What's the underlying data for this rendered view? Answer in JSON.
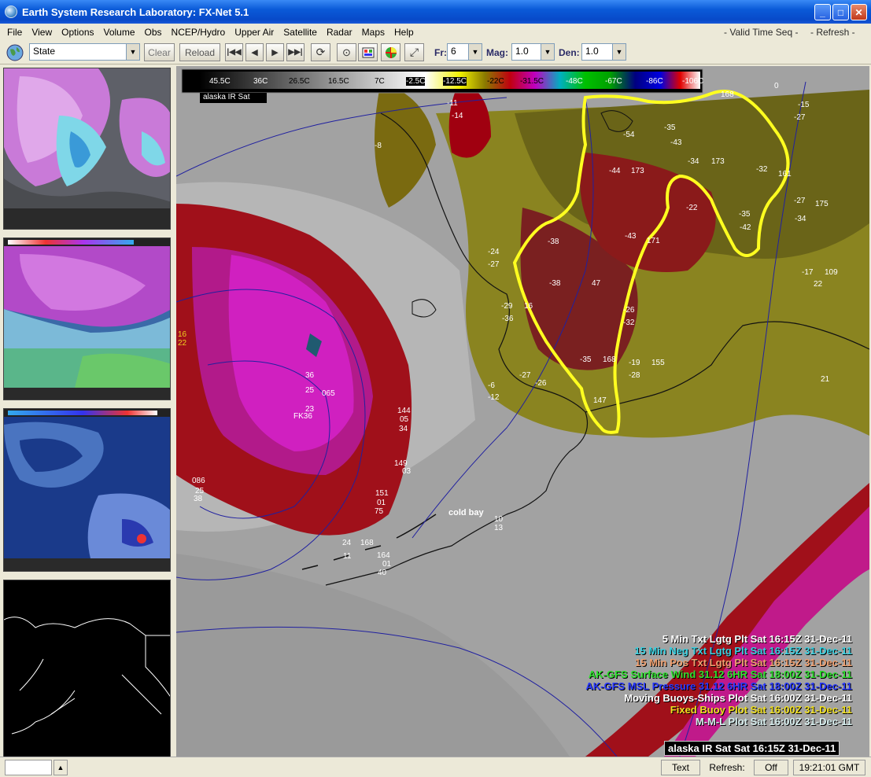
{
  "window": {
    "title": "Earth System Research Laboratory: FX-Net 5.1",
    "minimize": "_",
    "maximize": "□",
    "close": "✕"
  },
  "menu": {
    "items": [
      "File",
      "View",
      "Options",
      "Volume",
      "Obs",
      "NCEP/Hydro",
      "Upper Air",
      "Satellite",
      "Radar",
      "Maps",
      "Help"
    ],
    "valid_time_seq": "- Valid Time Seq -",
    "refresh": "- Refresh -"
  },
  "toolbar": {
    "scale_value": "State",
    "clear_label": "Clear",
    "reload_label": "Reload",
    "frames_label": "Fr:",
    "frames_value": "6",
    "mag_label": "Mag:",
    "mag_value": "1.0",
    "den_label": "Den:",
    "den_value": "1.0"
  },
  "colorbar": {
    "labels": [
      "45.5C",
      "36C",
      "26.5C",
      "16.5C",
      "7C",
      "-2.5C",
      "-12.5C",
      "-22C",
      "-31.5C",
      "-48C",
      "-67C",
      "-86C",
      "-106C"
    ],
    "product": "alaska IR Sat"
  },
  "map_labels": {
    "cold_bay": "cold bay",
    "station_numbers": [
      "-11",
      "-14",
      "-8",
      "-54",
      "-43",
      "-35",
      "-34",
      "173",
      "168",
      "-15",
      "-27",
      "-44",
      "173",
      "-32",
      "161",
      "-27",
      "175",
      "-34",
      "-22",
      "-35",
      "-42",
      "-38",
      "-43",
      "171",
      "-24",
      "-27",
      "-17",
      "109",
      "22",
      "-38",
      "47",
      "-29",
      "16",
      "-36",
      "-26",
      "-32",
      "-35",
      "168",
      "-19",
      "155",
      "-28",
      "-27",
      "-26",
      "147",
      "-6",
      "-12",
      "36",
      "25",
      "065",
      "23",
      "FK36",
      "144",
      "05",
      "34",
      "149",
      "03",
      "151",
      "01",
      "75",
      "24",
      "168",
      "11",
      "164",
      "01",
      "40",
      "086",
      "25",
      "38",
      "10",
      "13",
      "21",
      "0",
      "16",
      "22"
    ]
  },
  "legend": [
    {
      "text": "5 Min Txt Lgtg Plt Sat 16:15Z 31-Dec-11",
      "color": "#ffffff"
    },
    {
      "text": "15 Min Neg Txt Lgtg Plt Sat 16:15Z 31-Dec-11",
      "color": "#3ad0e0"
    },
    {
      "text": "15 Min Pos Txt Lgtg Plt Sat 16:15Z 31-Dec-11",
      "color": "#f0a070"
    },
    {
      "text": "AK-GFS Surface Wind  31.12   6HR Sat 18:00Z 31-Dec-11",
      "color": "#30e030"
    },
    {
      "text": "AK-GFS MSL Pressure  31.12   6HR Sat 18:00Z 31-Dec-11",
      "color": "#2a3aff"
    },
    {
      "text": "Moving Buoys-Ships Plot Sat 16:00Z 31-Dec-11",
      "color": "#ffffff"
    },
    {
      "text": "Fixed Buoy Plot Sat 16:00Z 31-Dec-11",
      "color": "#f0e020"
    },
    {
      "text": "M-M-L Plot Sat 16:00Z 31-Dec-11",
      "color": "#d8f0f0"
    }
  ],
  "image_caption": "alaska IR Sat Sat 16:15Z 31-Dec-11",
  "status": {
    "text_label": "Text",
    "refresh_label": "Refresh:",
    "refresh_value": "Off",
    "clock": "19:21:01 GMT"
  }
}
